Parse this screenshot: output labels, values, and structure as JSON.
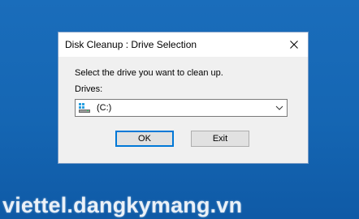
{
  "dialog": {
    "title": "Disk Cleanup : Drive Selection",
    "instruction": "Select the drive you want to clean up.",
    "drives_label": "Drives:",
    "selected_drive": "(C:)",
    "ok_label": "OK",
    "exit_label": "Exit",
    "icons": {
      "close": "close-icon",
      "drive": "windows-drive-icon",
      "dropdown": "chevron-down-icon"
    }
  },
  "watermark": "viettel.dangkymang.vn",
  "colors": {
    "desktop": "#1566b3",
    "dialog_bg": "#f0f0f0",
    "titlebar_bg": "#ffffff",
    "focus_border": "#0078d7"
  }
}
